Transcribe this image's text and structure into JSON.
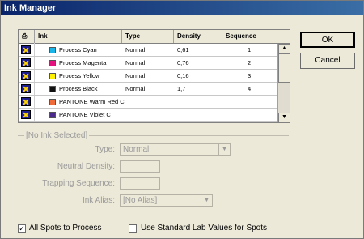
{
  "window": {
    "title": "Ink Manager"
  },
  "table": {
    "columns": {
      "icon": "",
      "ink": "Ink",
      "type": "Type",
      "density": "Density",
      "sequence": "Sequence"
    },
    "rows": [
      {
        "name": "Process Cyan",
        "swatch": "#19b5e8",
        "type": "Normal",
        "density": "0,61",
        "sequence": "1"
      },
      {
        "name": "Process Magenta",
        "swatch": "#e4137f",
        "type": "Normal",
        "density": "0,76",
        "sequence": "2"
      },
      {
        "name": "Process Yellow",
        "swatch": "#fff200",
        "type": "Normal",
        "density": "0,16",
        "sequence": "3"
      },
      {
        "name": "Process Black",
        "swatch": "#111111",
        "type": "Normal",
        "density": "1,7",
        "sequence": "4"
      },
      {
        "name": "PANTONE Warm Red C",
        "swatch": "#ef6b3a",
        "type": "",
        "density": "",
        "sequence": ""
      },
      {
        "name": "PANTONE Violet C",
        "swatch": "#4a2a8c",
        "type": "",
        "density": "",
        "sequence": ""
      }
    ]
  },
  "buttons": {
    "ok": "OK",
    "cancel": "Cancel"
  },
  "details": {
    "group_title": "[No Ink Selected]",
    "type_label": "Type:",
    "type_value": "Normal",
    "neutral_density_label": "Neutral Density:",
    "trapping_sequence_label": "Trapping Sequence:",
    "ink_alias_label": "Ink Alias:",
    "ink_alias_value": "[No Alias]"
  },
  "options": {
    "all_spots": {
      "label": "All Spots to Process",
      "checked": true
    },
    "lab_values": {
      "label": "Use Standard Lab Values for Spots",
      "checked": false
    }
  }
}
